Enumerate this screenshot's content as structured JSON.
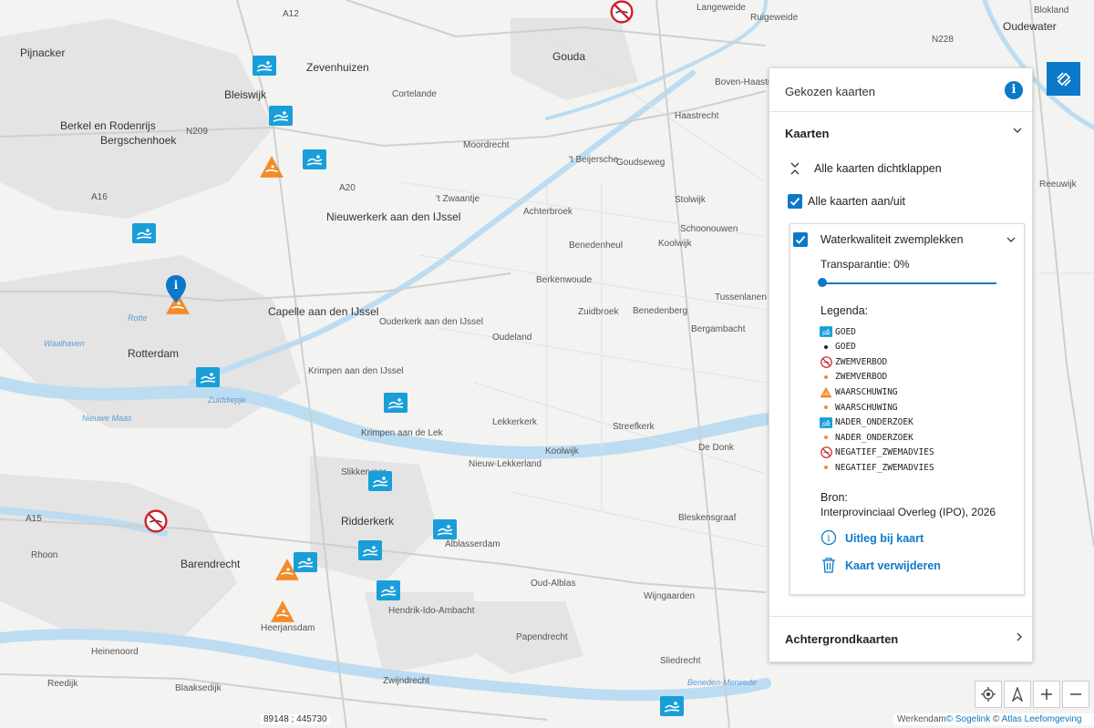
{
  "map": {
    "places": [
      {
        "name": "Pijnacker",
        "cls": "city"
      },
      {
        "name": "Bleiswijk",
        "cls": "city"
      },
      {
        "name": "Zevenhuizen",
        "cls": "city"
      },
      {
        "name": "Berkel en Rodenrijs",
        "cls": "city"
      },
      {
        "name": "Bergschenhoek",
        "cls": "city"
      },
      {
        "name": "Cortelande",
        "cls": ""
      },
      {
        "name": "Gouda",
        "cls": "city"
      },
      {
        "name": "Moordrecht",
        "cls": ""
      },
      {
        "name": "Nieuwerkerk aan den IJssel",
        "cls": "city"
      },
      {
        "name": "Capelle aan den IJssel",
        "cls": "city"
      },
      {
        "name": "Rotterdam",
        "cls": "city"
      },
      {
        "name": "Ouderkerk aan den IJssel",
        "cls": ""
      },
      {
        "name": "Krimpen aan den IJssel",
        "cls": ""
      },
      {
        "name": "Krimpen aan de Lek",
        "cls": ""
      },
      {
        "name": "Lekkerkerk",
        "cls": ""
      },
      {
        "name": "Nieuw-Lekkerland",
        "cls": ""
      },
      {
        "name": "Slikkerveer",
        "cls": ""
      },
      {
        "name": "Ridderkerk",
        "cls": "city"
      },
      {
        "name": "Barendrecht",
        "cls": "city"
      },
      {
        "name": "Rhoon",
        "cls": ""
      },
      {
        "name": "Heerjansdam",
        "cls": ""
      },
      {
        "name": "Alblasserdam",
        "cls": ""
      },
      {
        "name": "Hendrik-Ido-Ambacht",
        "cls": ""
      },
      {
        "name": "Zwijndrecht",
        "cls": ""
      },
      {
        "name": "Heinenoord",
        "cls": ""
      },
      {
        "name": "Reedijk",
        "cls": ""
      },
      {
        "name": "Blaaksedijk",
        "cls": ""
      },
      {
        "name": "Oud-Alblas",
        "cls": ""
      },
      {
        "name": "Papendrecht",
        "cls": ""
      },
      {
        "name": "Sliedrecht",
        "cls": ""
      },
      {
        "name": "Wijngaarden",
        "cls": ""
      },
      {
        "name": "Bleskensgraaf",
        "cls": ""
      },
      {
        "name": "Streefkerk",
        "cls": ""
      },
      {
        "name": "De Donk",
        "cls": ""
      },
      {
        "name": "Oudeland",
        "cls": ""
      },
      {
        "name": "Zuidbroek",
        "cls": ""
      },
      {
        "name": "Benedenberg",
        "cls": ""
      },
      {
        "name": "Bergambacht",
        "cls": ""
      },
      {
        "name": "Berkenwoude",
        "cls": ""
      },
      {
        "name": "Benedenheul",
        "cls": ""
      },
      {
        "name": "Achterbroek",
        "cls": ""
      },
      {
        "name": "'t Zwaantje",
        "cls": ""
      },
      {
        "name": "'t Beijersche",
        "cls": ""
      },
      {
        "name": "Goudseweg",
        "cls": ""
      },
      {
        "name": "Stolwijk",
        "cls": ""
      },
      {
        "name": "Koolwijk",
        "cls": ""
      },
      {
        "name": "Schoonouwen",
        "cls": ""
      },
      {
        "name": "Tussenlanen",
        "cls": ""
      },
      {
        "name": "Haastrecht",
        "cls": ""
      },
      {
        "name": "Boven-Haastrecht",
        "cls": ""
      },
      {
        "name": "Ruigeweide",
        "cls": ""
      },
      {
        "name": "Langeweide",
        "cls": ""
      },
      {
        "name": "Oudewater",
        "cls": "city"
      },
      {
        "name": "Blokland",
        "cls": ""
      },
      {
        "name": "N228",
        "cls": ""
      },
      {
        "name": "N209",
        "cls": ""
      },
      {
        "name": "A12",
        "cls": ""
      },
      {
        "name": "A20",
        "cls": ""
      },
      {
        "name": "A16",
        "cls": ""
      },
      {
        "name": "A15",
        "cls": ""
      },
      {
        "name": "Koolwijk",
        "cls": ""
      },
      {
        "name": "Nieuwe Maas",
        "cls": "water"
      },
      {
        "name": "Zuiddiepje",
        "cls": "water"
      },
      {
        "name": "Rotte",
        "cls": "water"
      },
      {
        "name": "Beneden-Merwede",
        "cls": "water"
      },
      {
        "name": "Waalhaven",
        "cls": "water"
      },
      {
        "name": "Reeuwijk",
        "cls": ""
      },
      {
        "name": "Ouderkerk",
        "cls": ""
      }
    ],
    "coordinates": "89148 ; 445730",
    "attribution_prefix": "Werkendam",
    "attribution_sogelink": "© Sogelink",
    "attribution_sep": " © ",
    "attribution_atlas": "Atlas Leefomgeving"
  },
  "panel": {
    "title": "Gekozen kaarten",
    "info_icon": "info-icon",
    "kaarten_title": "Kaarten",
    "collapse_all": "Alle kaarten dichtklappen",
    "toggle_all": "Alle kaarten aan/uit",
    "layer": {
      "name": "Waterkwaliteit zwemplekken",
      "transparency_label": "Transparantie: 0%",
      "transparency_value": 0,
      "legend_title": "Legenda:",
      "legend": [
        {
          "label": "GOED",
          "symbol": "good-icon"
        },
        {
          "label": "GOED",
          "symbol": "dot",
          "color": "#222222"
        },
        {
          "label": "ZWEMVERBOD",
          "symbol": "ban-icon"
        },
        {
          "label": "ZWEMVERBOD",
          "symbol": "dot",
          "color": "#f28c28"
        },
        {
          "label": "WAARSCHUWING",
          "symbol": "warn-icon"
        },
        {
          "label": "WAARSCHUWING",
          "symbol": "dot",
          "color": "#f28c28"
        },
        {
          "label": "NADER_ONDERZOEK",
          "symbol": "good-icon"
        },
        {
          "label": "NADER_ONDERZOEK",
          "symbol": "dot",
          "color": "#f28c28"
        },
        {
          "label": "NEGATIEF_ZWEMADVIES",
          "symbol": "ban-icon"
        },
        {
          "label": "NEGATIEF_ZWEMADVIES",
          "symbol": "dot",
          "color": "#f28c28"
        }
      ],
      "source_title": "Bron:",
      "source_text": "Interprovinciaal Overleg (IPO), 2026",
      "explain_link": "Uitleg bij kaart",
      "remove_link": "Kaart verwijderen"
    },
    "background_title": "Achtergrondkaarten"
  },
  "colors": {
    "accent": "#0b79c9",
    "good": "#1a9ed9",
    "warning": "#f28c28",
    "ban": "#d0202a"
  }
}
